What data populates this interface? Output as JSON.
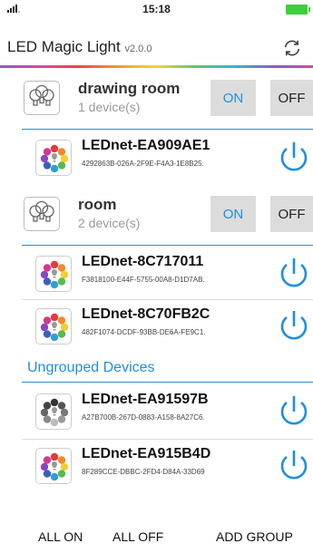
{
  "status": {
    "time": "15:18"
  },
  "header": {
    "title": "LED Magic Light",
    "version": "v2.0.0"
  },
  "groups": [
    {
      "name": "drawing room",
      "count": "1 device(s)",
      "on_label": "ON",
      "off_label": "OFF"
    },
    {
      "name": "room",
      "count": "2 device(s)",
      "on_label": "ON",
      "off_label": "OFF"
    }
  ],
  "devices": [
    {
      "name": "LEDnet-EA909AE1",
      "id": "4292863B-026A-2F9E-F4A3-1E8B25.",
      "icon": "color-bulb-icon"
    },
    {
      "name": "LEDnet-8C717011",
      "id": "F3818100-E44F-5755-00A8-D1D7AB.",
      "icon": "color-bulb-icon"
    },
    {
      "name": "LEDnet-8C70FB2C",
      "id": "482F1074-DCDF-93BB-DE6A-FE9C1.",
      "icon": "color-bulb-icon"
    },
    {
      "name": "LEDnet-EA91597B",
      "id": "A27B700B-267D-0883-A158-8A27C6.",
      "icon": "grey-bulb-icon"
    },
    {
      "name": "LEDnet-EA915B4D",
      "id": "8F289CCE-DBBC-2FD4-D84A-33D69",
      "icon": "color-bulb-icon"
    }
  ],
  "ungrouped_label": "Ungrouped Devices",
  "footer": {
    "all_on": "ALL ON",
    "all_off": "ALL OFF",
    "add_group": "ADD GROUP"
  },
  "colors": {
    "accent": "#1f8fe0",
    "button_bg": "#dcdcdc",
    "battery": "#3ccf3c"
  }
}
